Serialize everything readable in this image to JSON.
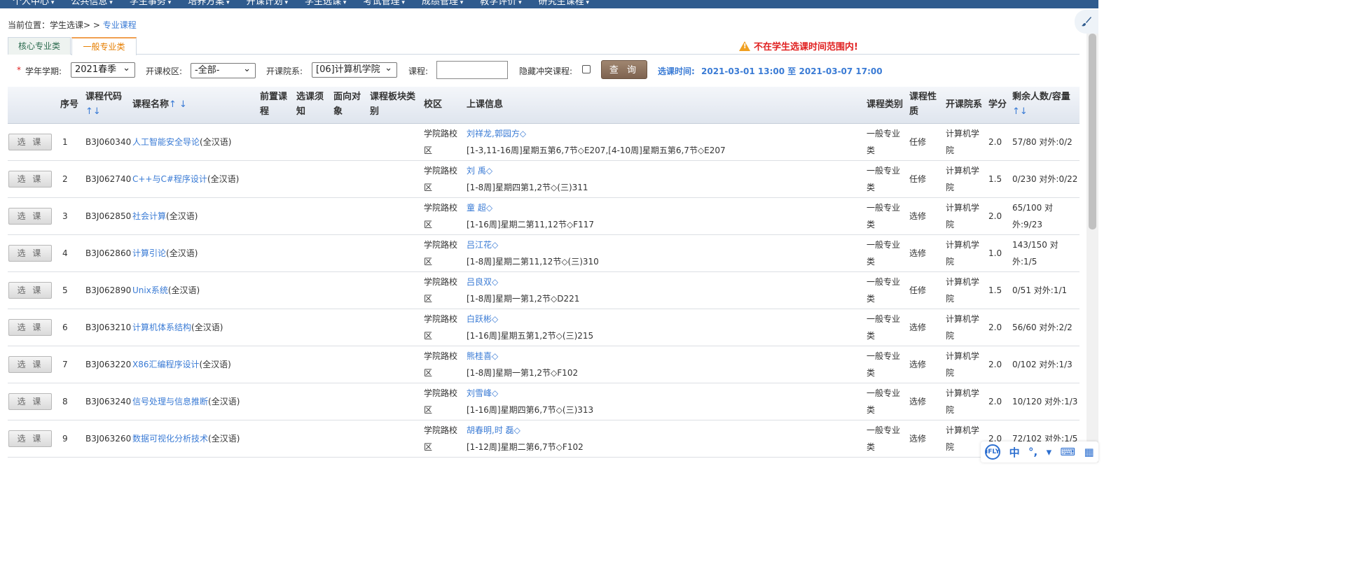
{
  "nav": {
    "items": [
      "个人中心",
      "公共信息",
      "学生事务",
      "培养方案",
      "开课计划",
      "学生选课",
      "考试管理",
      "成绩管理",
      "教学评价",
      "研究生课程"
    ]
  },
  "breadcrumb": {
    "prefix": "当前位置：学生选课> >",
    "current": "专业课程"
  },
  "tabs": {
    "core": "核心专业类",
    "general": "一般专业类"
  },
  "warning": "不在学生选课时间范围内!",
  "filters": {
    "term_label": "学年学期:",
    "term_value": "2021春季",
    "campus_label": "开课校区:",
    "campus_value": "-全部-",
    "dept_label": "开课院系:",
    "dept_value": "[06]计算机学院",
    "course_label": "课程:",
    "course_value": "",
    "hide_conflict_label": "隐藏冲突课程:",
    "query_button": "查 询",
    "time_label": "选课时间:",
    "time_value": "2021-03-01 13:00 至  2021-03-07 17:00"
  },
  "table": {
    "headers": {
      "index": "序号",
      "code": "课程代码",
      "name": "课程名称",
      "prereq_1": "前置课",
      "prereq_2": "程",
      "notice_1": "选课须",
      "notice_2": "知",
      "target_1": "面向对",
      "target_2": "象",
      "block_1": "课程板块类",
      "block_2": "别",
      "campus": "校区",
      "schedule": "上课信息",
      "category": "课程类别",
      "nature_1": "课程性",
      "nature_2": "质",
      "dept": "开课院系",
      "credit": "学分",
      "remain": "剩余人数/容量"
    },
    "select_label": "选 课",
    "rows": [
      {
        "index": "1",
        "code": "B3J060340",
        "name": "人工智能安全导论",
        "lang": "(全汉语)",
        "campus_1": "学院路校",
        "campus_2": "区",
        "teacher": "刘祥龙,郭园方◇",
        "schedule": "[1-3,11-16周]星期五第6,7节◇E207,[4-10周]星期五第6,7节◇E207",
        "cat_1": "一般专业",
        "cat_2": "类",
        "nature": "任修",
        "dept_1": "计算机学",
        "dept_2": "院",
        "credit": "2.0",
        "remain_1": "57/80 对外:0/2",
        "remain_2": ""
      },
      {
        "index": "2",
        "code": "B3J062740",
        "name": "C++与C#程序设计",
        "lang": "(全汉语)",
        "campus_1": "学院路校",
        "campus_2": "区",
        "teacher": "刘 禹◇",
        "schedule": "[1-8周]星期四第1,2节◇(三)311",
        "cat_1": "一般专业",
        "cat_2": "类",
        "nature": "任修",
        "dept_1": "计算机学",
        "dept_2": "院",
        "credit": "1.5",
        "remain_1": "0/230 对外:0/22",
        "remain_2": ""
      },
      {
        "index": "3",
        "code": "B3J062850",
        "name": "社会计算",
        "lang": "(全汉语)",
        "campus_1": "学院路校",
        "campus_2": "区",
        "teacher": "童 超◇",
        "schedule": "[1-16周]星期二第11,12节◇F117",
        "cat_1": "一般专业",
        "cat_2": "类",
        "nature": "选修",
        "dept_1": "计算机学",
        "dept_2": "院",
        "credit": "2.0",
        "remain_1": "65/100 对",
        "remain_2": "外:9/23"
      },
      {
        "index": "4",
        "code": "B3J062860",
        "name": "计算引论",
        "lang": "(全汉语)",
        "campus_1": "学院路校",
        "campus_2": "区",
        "teacher": "吕江花◇",
        "schedule": "[1-8周]星期二第11,12节◇(三)310",
        "cat_1": "一般专业",
        "cat_2": "类",
        "nature": "选修",
        "dept_1": "计算机学",
        "dept_2": "院",
        "credit": "1.0",
        "remain_1": "143/150 对",
        "remain_2": "外:1/5"
      },
      {
        "index": "5",
        "code": "B3J062890",
        "name": "Unix系统",
        "lang": "(全汉语)",
        "campus_1": "学院路校",
        "campus_2": "区",
        "teacher": "吕良双◇",
        "schedule": "[1-8周]星期一第1,2节◇D221",
        "cat_1": "一般专业",
        "cat_2": "类",
        "nature": "任修",
        "dept_1": "计算机学",
        "dept_2": "院",
        "credit": "1.5",
        "remain_1": "0/51 对外:1/1",
        "remain_2": ""
      },
      {
        "index": "6",
        "code": "B3J063210",
        "name": "计算机体系结构",
        "lang": "(全汉语)",
        "campus_1": "学院路校",
        "campus_2": "区",
        "teacher": "白跃彬◇",
        "schedule": "[1-16周]星期五第1,2节◇(三)215",
        "cat_1": "一般专业",
        "cat_2": "类",
        "nature": "选修",
        "dept_1": "计算机学",
        "dept_2": "院",
        "credit": "2.0",
        "remain_1": "56/60 对外:2/2",
        "remain_2": ""
      },
      {
        "index": "7",
        "code": "B3J063220",
        "name": "X86汇编程序设计",
        "lang": "(全汉语)",
        "campus_1": "学院路校",
        "campus_2": "区",
        "teacher": "熊桂喜◇",
        "schedule": "[1-8周]星期一第1,2节◇F102",
        "cat_1": "一般专业",
        "cat_2": "类",
        "nature": "选修",
        "dept_1": "计算机学",
        "dept_2": "院",
        "credit": "2.0",
        "remain_1": "0/102 对外:1/3",
        "remain_2": ""
      },
      {
        "index": "8",
        "code": "B3J063240",
        "name": "信号处理与信息推断",
        "lang": "(全汉语)",
        "campus_1": "学院路校",
        "campus_2": "区",
        "teacher": "刘雪峰◇",
        "schedule": "[1-16周]星期四第6,7节◇(三)313",
        "cat_1": "一般专业",
        "cat_2": "类",
        "nature": "选修",
        "dept_1": "计算机学",
        "dept_2": "院",
        "credit": "2.0",
        "remain_1": "10/120 对外:1/3",
        "remain_2": ""
      },
      {
        "index": "9",
        "code": "B3J063260",
        "name": "数据可视化分析技术",
        "lang": "(全汉语)",
        "campus_1": "学院路校",
        "campus_2": "区",
        "teacher": "胡春明,时 磊◇",
        "schedule": "[1-12周]星期二第6,7节◇F102",
        "cat_1": "一般专业",
        "cat_2": "类",
        "nature": "选修",
        "dept_1": "计算机学",
        "dept_2": "院",
        "credit": "2.0",
        "remain_1": "72/102 对外:1/5",
        "remain_2": ""
      }
    ]
  },
  "ime": {
    "brand": "iFLY",
    "mode": "中"
  }
}
